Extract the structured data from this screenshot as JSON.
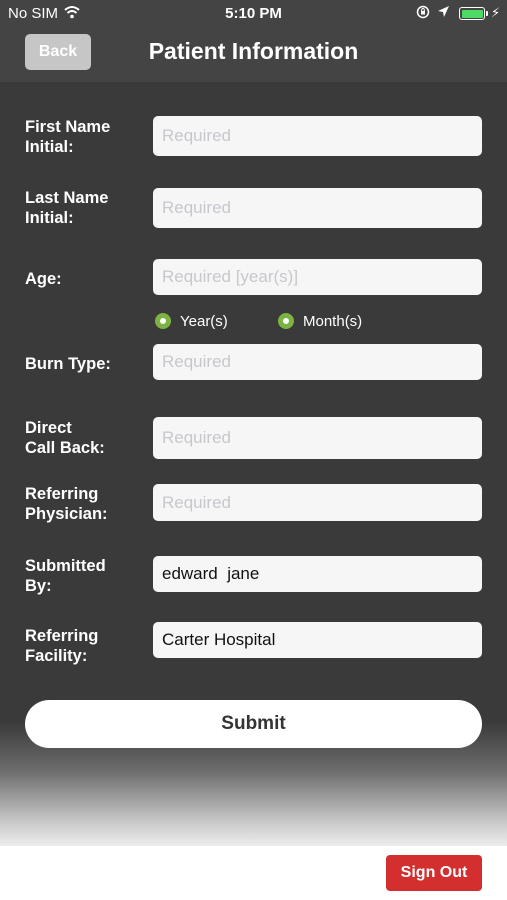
{
  "status_bar": {
    "carrier": "No SIM",
    "time": "5:10 PM",
    "wifi_icon": "wifi-icon",
    "lock_icon": "orientation-lock-icon",
    "location_icon": "location-arrow-icon",
    "battery_icon": "battery-icon",
    "charging_icon": "charging-bolt-icon"
  },
  "nav": {
    "back_label": "Back",
    "title": "Patient Information"
  },
  "form": {
    "first_name_initial": {
      "label": "First Name\nInitial:",
      "value": "",
      "placeholder": "Required"
    },
    "last_name_initial": {
      "label": "Last Name\nInitial:",
      "value": "",
      "placeholder": "Required"
    },
    "age": {
      "label": "Age:",
      "value": "",
      "placeholder": "Required [year(s)]"
    },
    "age_unit": {
      "options": [
        "Year(s)",
        "Month(s)"
      ],
      "selected": "Year(s)"
    },
    "burn_type": {
      "label": "Burn Type:",
      "value": "",
      "placeholder": "Required"
    },
    "direct_call_back": {
      "label": "Direct\nCall Back:",
      "value": "",
      "placeholder": "Required"
    },
    "referring_physician": {
      "label": "Referring\nPhysician:",
      "value": "",
      "placeholder": "Required"
    },
    "submitted_by": {
      "label": "Submitted\nBy:",
      "value": "edward  jane",
      "placeholder": ""
    },
    "referring_facility": {
      "label": "Referring\nFacility:",
      "value": "Carter Hospital",
      "placeholder": ""
    }
  },
  "submit_label": "Submit",
  "sign_out_label": "Sign Out",
  "colors": {
    "header": "#444444",
    "form_background": "#3a3a3a",
    "radio_accent": "#7cb342",
    "sign_out": "#d32f2f",
    "placeholder": "#c7c7cd"
  }
}
